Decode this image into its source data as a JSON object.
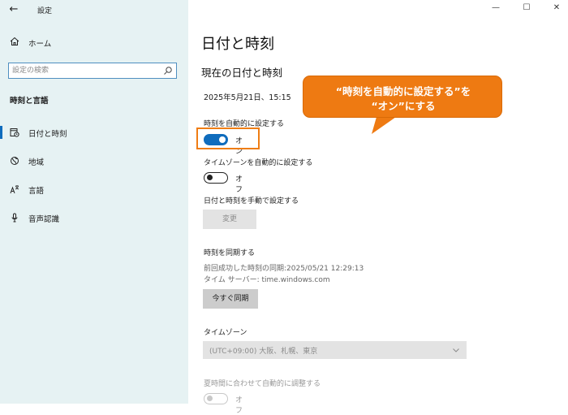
{
  "window": {
    "app_title": "設定",
    "back_symbol": "←",
    "minimize": "—",
    "maximize": "☐",
    "close": "✕"
  },
  "sidebar": {
    "home_label": "ホーム",
    "search_placeholder": "設定の検索",
    "section_title": "時刻と言語",
    "items": [
      {
        "label": "日付と時刻",
        "icon": "calendar-clock-icon",
        "active": true
      },
      {
        "label": "地域",
        "icon": "globe-icon",
        "active": false
      },
      {
        "label": "言語",
        "icon": "language-icon",
        "active": false
      },
      {
        "label": "音声認識",
        "icon": "microphone-icon",
        "active": false
      }
    ]
  },
  "main": {
    "page_title": "日付と時刻",
    "current_section_title": "現在の日付と時刻",
    "current_datetime": "2025年5月21日、15:15",
    "auto_time": {
      "label": "時刻を自動的に設定する",
      "state": "オン",
      "on": true
    },
    "auto_timezone": {
      "label": "タイムゾーンを自動的に設定する",
      "state": "オフ",
      "on": false
    },
    "manual": {
      "label": "日付と時刻を手動で設定する",
      "button": "変更"
    },
    "sync": {
      "title": "時刻を同期する",
      "last_sync": "前回成功した時刻の同期:2025/05/21 12:29:13",
      "server": "タイム サーバー: time.windows.com",
      "button": "今すぐ同期"
    },
    "timezone": {
      "label": "タイムゾーン",
      "value": "(UTC+09:00) 大阪、札幌、東京"
    },
    "dst": {
      "label": "夏時間に合わせて自動的に調整する",
      "state": "オフ"
    }
  },
  "callout": {
    "line1": "“時刻を自動的に設定する”を",
    "line2": "“オン”にする",
    "color": "#ee7a12",
    "highlight_color": "#ef7d14"
  },
  "colors": {
    "accent": "#0f6cbd",
    "sidebar_bg": "#e6f2f3"
  }
}
